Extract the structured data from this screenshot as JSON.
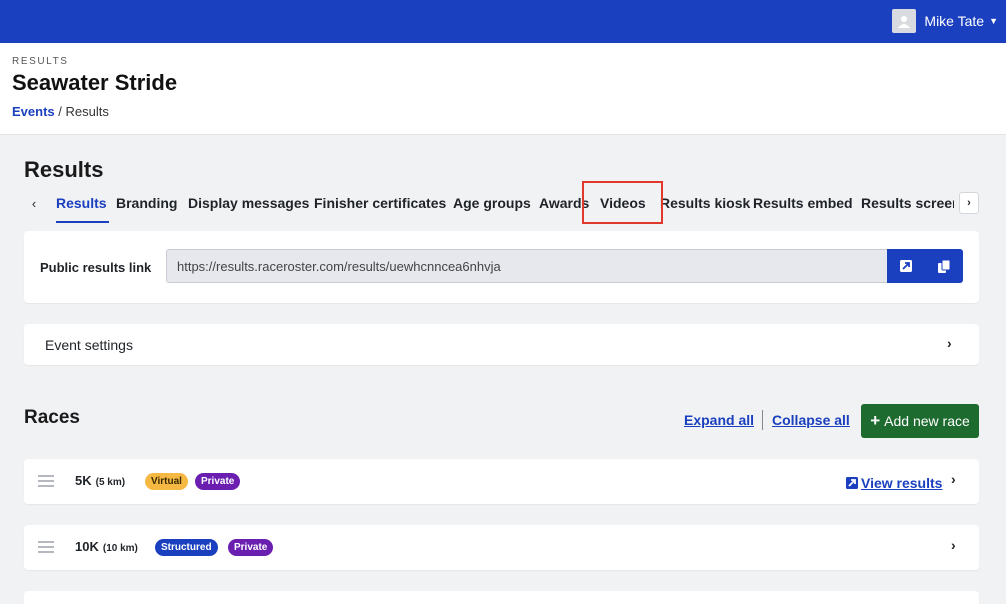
{
  "topbar": {
    "user_name": "Mike Tate"
  },
  "header": {
    "eyebrow": "RESULTS",
    "title": "Seawater Stride",
    "breadcrumb": {
      "events": "Events",
      "sep": " / ",
      "current": "Results"
    }
  },
  "section": {
    "title": "Results"
  },
  "tabs": [
    {
      "label": "Results",
      "active": true
    },
    {
      "label": "Branding"
    },
    {
      "label": "Display messages"
    },
    {
      "label": "Finisher certificates"
    },
    {
      "label": "Age groups"
    },
    {
      "label": "Awards"
    },
    {
      "label": "Videos"
    },
    {
      "label": "Results kiosk"
    },
    {
      "label": "Results embed"
    },
    {
      "label": "Results screen"
    }
  ],
  "public_link": {
    "label": "Public results link",
    "url": "https://results.raceroster.com/results/uewhcnncea6nhvja"
  },
  "event_settings": {
    "label": "Event settings"
  },
  "races": {
    "title": "Races",
    "expand_all": "Expand all",
    "collapse_all": "Collapse all",
    "add_label": "Add new race",
    "items": [
      {
        "name": "5K",
        "distance": "(5 km)",
        "badges": [
          "Virtual",
          "Private"
        ],
        "view_results": "View results"
      },
      {
        "name": "10K",
        "distance": "(10 km)",
        "badges": [
          "Structured",
          "Private"
        ]
      }
    ]
  },
  "colors": {
    "brand": "#1a3fbf",
    "success": "#1d6b2f",
    "virtual": "#f5b842",
    "private": "#6a1fb0",
    "highlight": "#e0392b"
  }
}
